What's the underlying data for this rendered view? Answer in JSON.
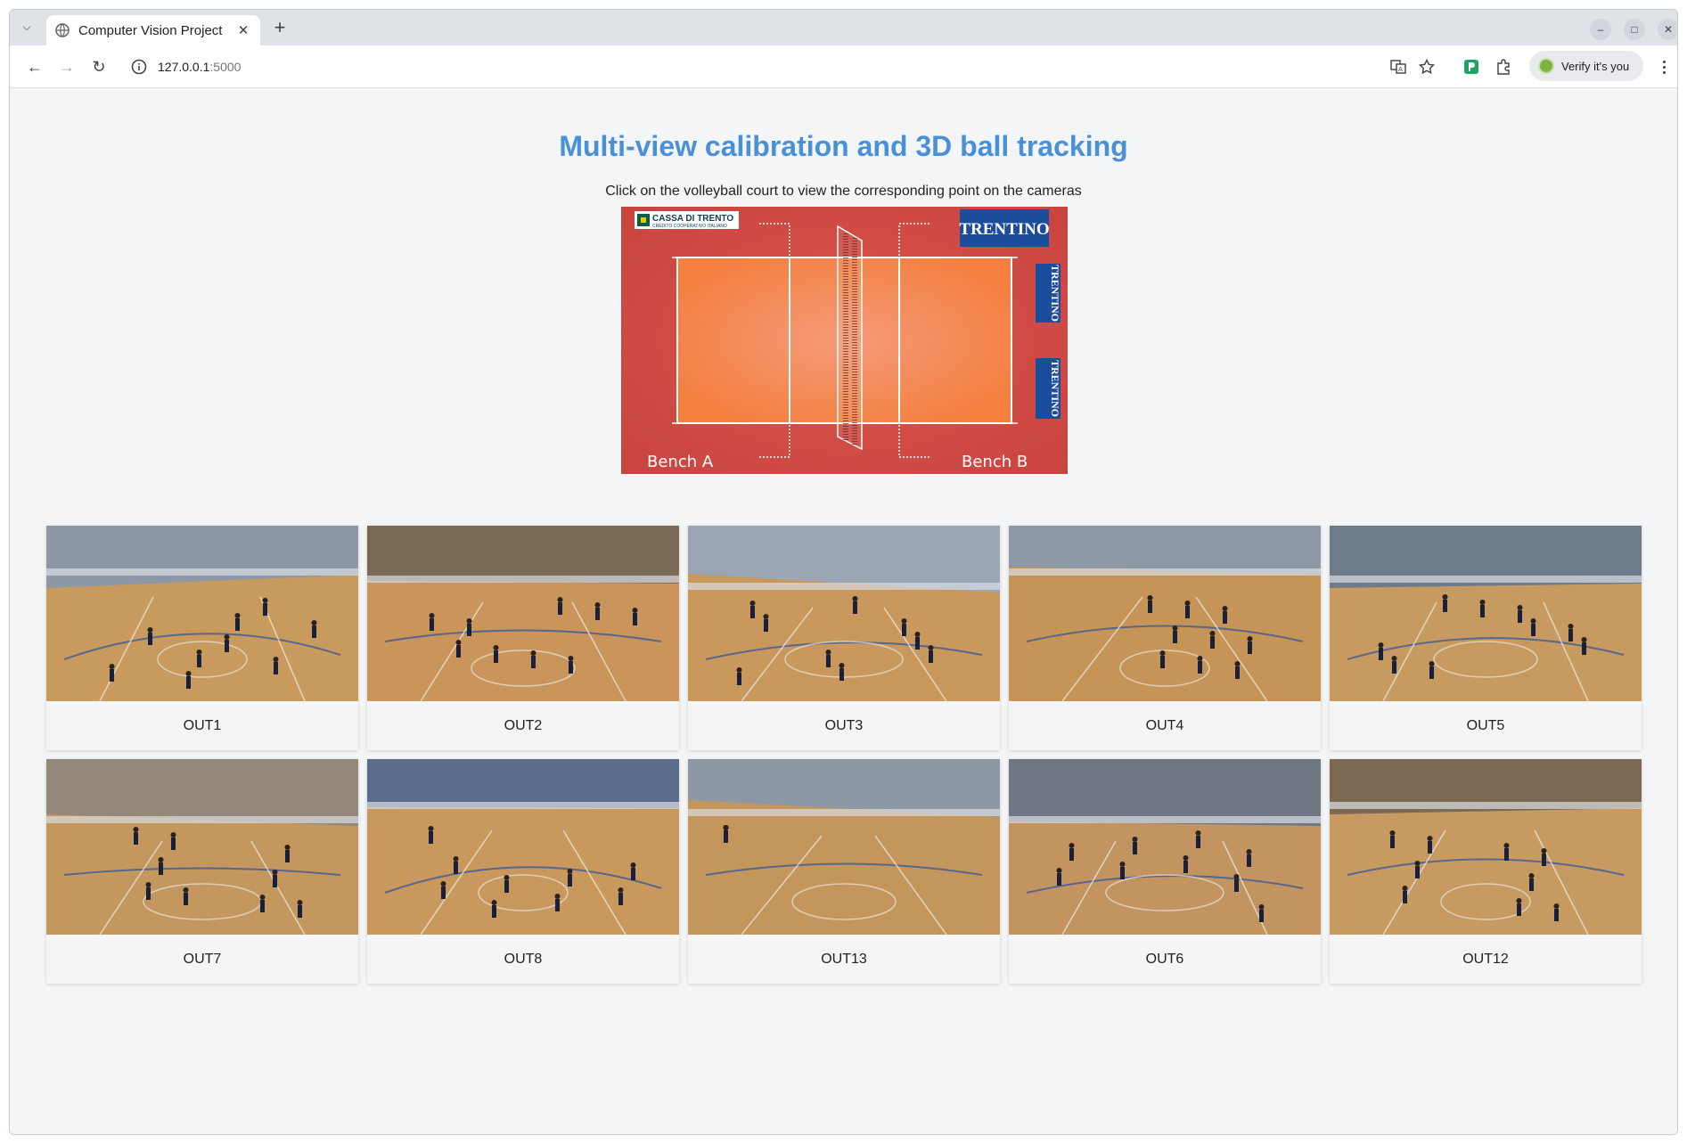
{
  "browser": {
    "tab_title": "Computer Vision Project",
    "url_host": "127.0.0.1",
    "url_port": ":5000",
    "verify_label": "Verify it's you"
  },
  "page": {
    "title": "Multi-view calibration and 3D ball tracking",
    "subtitle": "Click on the volleyball court to view the corresponding point on the cameras"
  },
  "court": {
    "sponsor_top_left": "CASSA DI TRENTO",
    "sponsor_top_left_sub": "CREDITO COOPERATIVO ITALIANO",
    "logo_text": "TRENTINO",
    "bench_a": "Bench A",
    "bench_b": "Bench B",
    "colors": {
      "outer": "#cf4a44",
      "inner": "#f4844a",
      "line": "#ffffff",
      "logo_bg": "#1c4c9c"
    }
  },
  "cameras": [
    {
      "label": "OUT1",
      "variant": "a"
    },
    {
      "label": "OUT2",
      "variant": "b"
    },
    {
      "label": "OUT3",
      "variant": "c"
    },
    {
      "label": "OUT4",
      "variant": "d"
    },
    {
      "label": "OUT5",
      "variant": "e"
    },
    {
      "label": "OUT7",
      "variant": "f"
    },
    {
      "label": "OUT8",
      "variant": "g"
    },
    {
      "label": "OUT13",
      "variant": "h"
    },
    {
      "label": "OUT6",
      "variant": "i"
    },
    {
      "label": "OUT12",
      "variant": "j"
    }
  ]
}
